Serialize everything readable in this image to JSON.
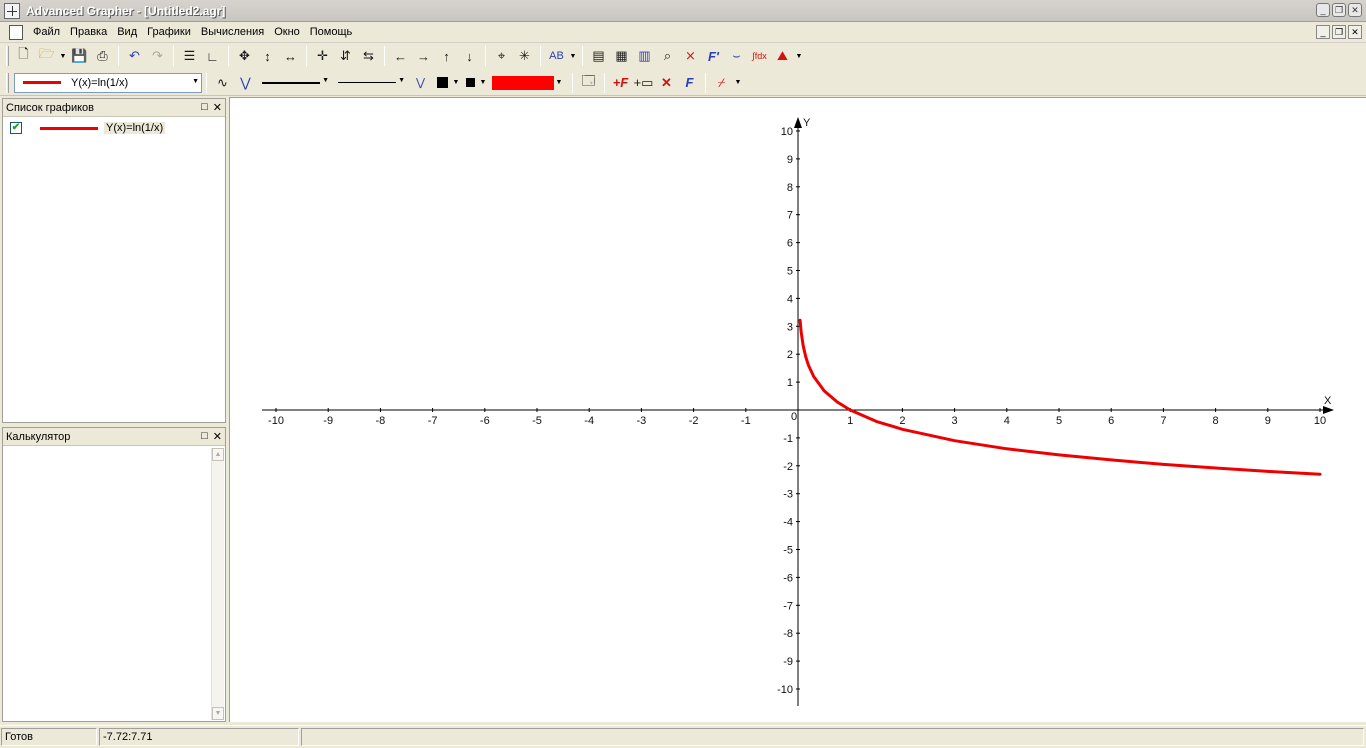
{
  "window": {
    "title": "Advanced Grapher - [Untitled2.agr]",
    "buttons": [
      "minimize",
      "restore",
      "close"
    ]
  },
  "menu": {
    "items": [
      "Файл",
      "Правка",
      "Вид",
      "Графики",
      "Вычисления",
      "Окно",
      "Помощь"
    ]
  },
  "toolbar": {
    "row1_icons": [
      "new-document-icon",
      "open-folder-icon",
      "save-icon",
      "print-icon",
      "undo-icon",
      "redo-icon",
      "graph-list-icon",
      "axes-icon",
      "move-icon",
      "vertical-move-icon",
      "horizontal-move-icon",
      "zoom-in-icon",
      "zoom-in-vertical-icon",
      "zoom-in-horizontal-icon",
      "left-arrow-icon",
      "right-arrow-icon",
      "up-arrow-icon",
      "down-arrow-icon",
      "crosshair-icon",
      "fit-icon",
      "text-label-icon",
      "document-properties-icon",
      "calculator-icon",
      "table-icon",
      "find-value-icon",
      "intersection-icon",
      "derivative-icon",
      "tangent-icon",
      "integral-icon",
      "statistics-icon"
    ],
    "text_label": "AB",
    "derivative_label": "F'",
    "integral_label": "∫fdx"
  },
  "format_bar": {
    "function_select": "Y(x)=ln(1/x)",
    "line_color": "#ee0000",
    "fill_color": "#ff0000"
  },
  "graph_list_panel": {
    "title": "Список графиков",
    "items": [
      {
        "label": "Y(x)=ln(1/x)",
        "checked": true,
        "color": "#ee0000"
      }
    ]
  },
  "calculator_panel": {
    "title": "Калькулятор"
  },
  "chart_data": {
    "type": "line",
    "title": "",
    "xlabel": "X",
    "ylabel": "Y",
    "xlim": [
      -10,
      10
    ],
    "ylim": [
      -10,
      10
    ],
    "x_ticks": [
      -10,
      -9,
      -8,
      -7,
      -6,
      -5,
      -4,
      -3,
      -2,
      -1,
      0,
      1,
      2,
      3,
      4,
      5,
      6,
      7,
      8,
      9,
      10
    ],
    "y_ticks": [
      -10,
      -9,
      -8,
      -7,
      -6,
      -5,
      -4,
      -3,
      -2,
      -1,
      1,
      2,
      3,
      4,
      5,
      6,
      7,
      8,
      9,
      10
    ],
    "grid": false,
    "series": [
      {
        "name": "Y(x)=ln(1/x)",
        "color": "#ee0000",
        "x": [
          0.04,
          0.06,
          0.1,
          0.15,
          0.2,
          0.3,
          0.5,
          0.75,
          1,
          1.5,
          2,
          3,
          4,
          5,
          6,
          7,
          8,
          9,
          10
        ],
        "y": [
          3.22,
          2.81,
          2.3,
          1.9,
          1.61,
          1.2,
          0.69,
          0.29,
          0,
          -0.41,
          -0.69,
          -1.1,
          -1.39,
          -1.61,
          -1.79,
          -1.95,
          -2.08,
          -2.2,
          -2.3
        ]
      }
    ]
  },
  "status_bar": {
    "state": "Готов",
    "coords": "-7.72:7.71"
  }
}
